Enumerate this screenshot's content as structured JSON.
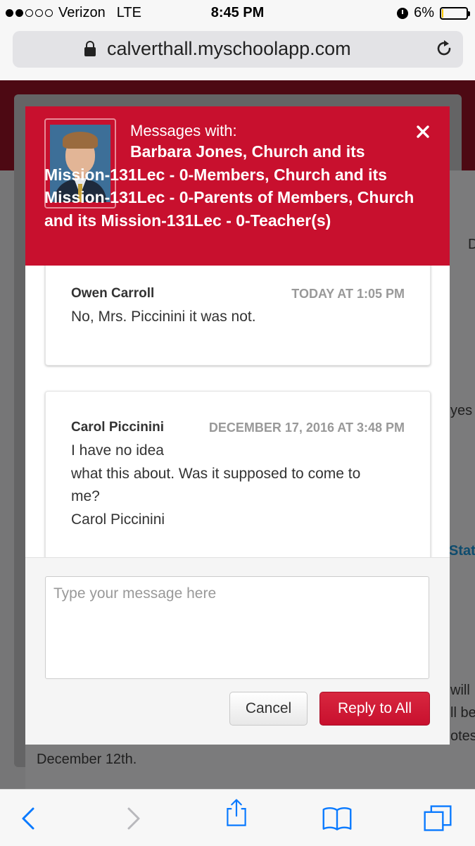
{
  "status_bar": {
    "signal_filled": 2,
    "signal_total": 5,
    "carrier": "Verizon",
    "network": "LTE",
    "time": "8:45 PM",
    "battery_percent": "6%",
    "battery_level": 0.06,
    "icons": [
      "alarm-icon",
      "battery-icon"
    ]
  },
  "browser": {
    "url": "calverthall.myschoolapp.com",
    "icons": [
      "lock-icon",
      "reload-icon"
    ]
  },
  "background": {
    "snippets": [
      "D",
      "yes",
      "Stat",
      "will",
      "ll be",
      "otes",
      "December 12th."
    ],
    "banner_color": "#4d0913"
  },
  "modal": {
    "header_label": "Messages with:",
    "recipients": "Barbara Jones, Church and its Mission-131Lec - 0-Members, Church and its Mission-131Lec - 0-Parents of Members, Church and its Mission-131Lec - 0-Teacher(s)",
    "accent_color": "#c8102e",
    "messages": [
      {
        "sender": "Owen Carroll",
        "date": "TODAY AT 1:05 PM",
        "lines": [
          "No, Mrs. Piccinini it was not."
        ]
      },
      {
        "sender": "Carol Piccinini",
        "date": "DECEMBER 17, 2016 AT 3:48 PM",
        "lines": [
          "I have no idea",
          "what this about. Was it supposed to come to",
          "me?",
          "Carol Piccinini"
        ]
      }
    ],
    "reply_placeholder": "Type your message here",
    "cancel_label": "Cancel",
    "reply_label": "Reply to All"
  },
  "toolbar": {
    "icons": [
      "back-icon",
      "forward-icon",
      "share-icon",
      "bookmarks-icon",
      "tabs-icon"
    ]
  }
}
